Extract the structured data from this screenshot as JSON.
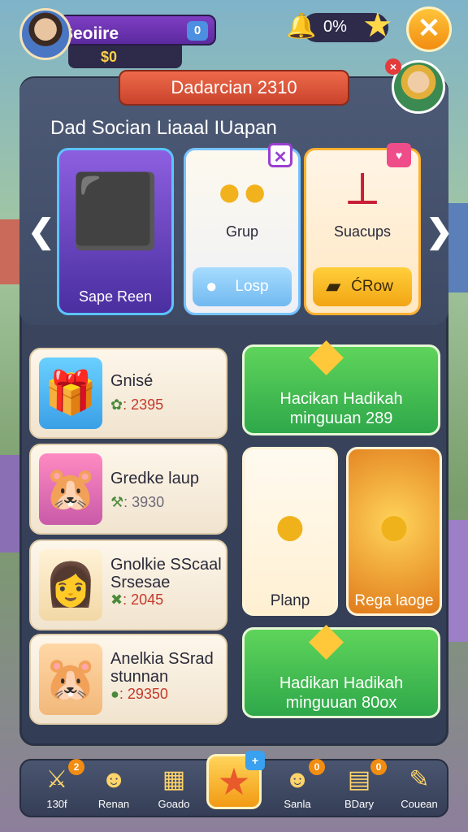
{
  "player": {
    "name": "Seoiire",
    "level_badge": "0",
    "coins": "$0"
  },
  "progress": {
    "value": "0%"
  },
  "event": {
    "title": "Dadarcian 2310",
    "subtitle": "Dad Socian Liaaal IUapan",
    "prev_arrow": "❮",
    "next_arrow": "❯",
    "offers": [
      {
        "title": "Sape Reen",
        "button": ""
      },
      {
        "title": "Grup",
        "button": "Losp"
      },
      {
        "title": "Suacups",
        "button": "ĆRow"
      }
    ]
  },
  "list": [
    {
      "name": "Gnisé",
      "value": ": 2395",
      "symbol": "✿"
    },
    {
      "name": "Gredke laup",
      "value": ": 3930",
      "symbol": "⚒"
    },
    {
      "name": "Gnolkie SScaal Srsesae",
      "value": ": 2045",
      "symbol": "✖"
    },
    {
      "name": "Anelkia SSrad stunnan",
      "value": ": 29350",
      "symbol": "●"
    }
  ],
  "green_cards": [
    {
      "line1": "Hacikan Hadikah",
      "line2": "minguuan 289"
    },
    {
      "line1": "Hadikan Hadikah",
      "line2": "minguuan 80ox"
    }
  ],
  "coin_cards": [
    {
      "label": "Planp"
    },
    {
      "label": "Rega laoge"
    }
  ],
  "nav": [
    {
      "label": "130f",
      "badge": "2"
    },
    {
      "label": "Renan",
      "badge": ""
    },
    {
      "label": "Goado",
      "badge": ""
    },
    {
      "label": "Sanla",
      "badge": "0"
    },
    {
      "label": "BDary",
      "badge": "0"
    },
    {
      "label": "Couean",
      "badge": ""
    }
  ],
  "nav_center_badge": "+"
}
